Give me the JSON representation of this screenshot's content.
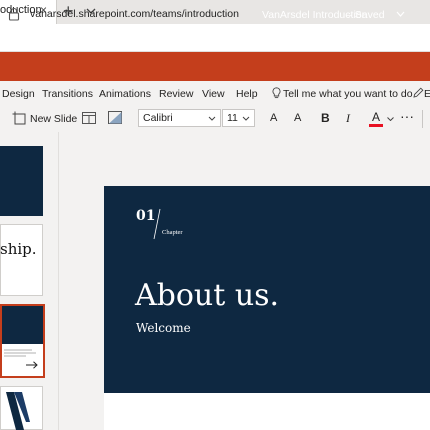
{
  "browser": {
    "tab_title": "oduction",
    "tab_close": "×",
    "new_tab": "+",
    "url": "vanarsdel.sharepoint.com/teams/introduction"
  },
  "app": {
    "doc_title": "VanArsdel Introduction",
    "doc_status": "– Saved",
    "accent": "#c43e1c"
  },
  "ribbon_tabs": [
    "Design",
    "Transitions",
    "Animations",
    "Review",
    "View",
    "Help"
  ],
  "tell_me": "Tell me what you want to do",
  "ribbon_edit": "Ed",
  "toolbar": {
    "new_slide": "New Slide",
    "font": "Calibri",
    "size": "11",
    "grow": "A",
    "shrink": "A",
    "bold": "B",
    "italic": "I",
    "font_color": "A",
    "more": "···"
  },
  "thumbnails": {
    "thumb2_text": "ship."
  },
  "slide": {
    "chapter_number": "01",
    "chapter_label": "Chapter",
    "heading": "About us.",
    "subheading": "Welcome",
    "band_color": "#0e2841"
  }
}
